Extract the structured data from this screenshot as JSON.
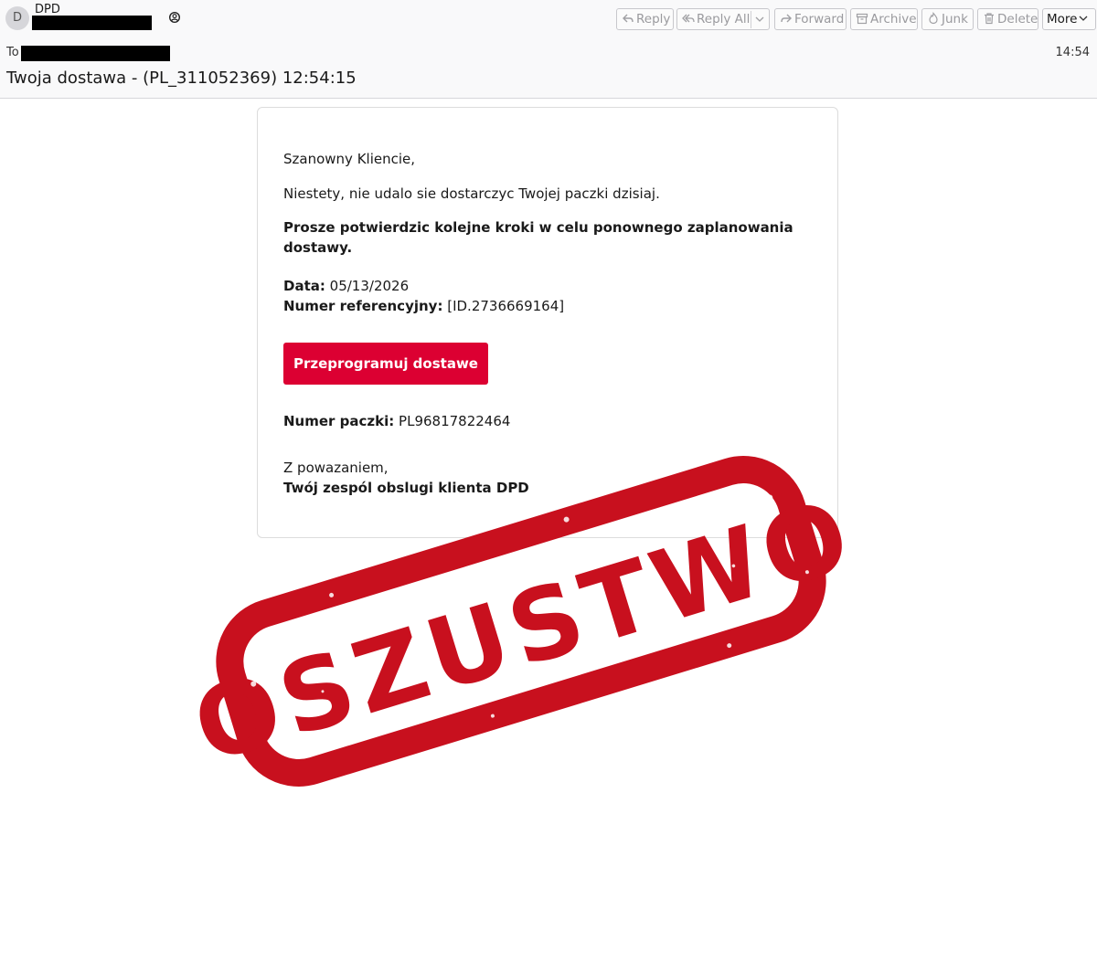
{
  "header": {
    "avatar_initial": "D",
    "from_name": "DPD",
    "to_label": "To",
    "time": "14:54",
    "subject": "Twoja dostawa - (PL_311052369) 12:54:15"
  },
  "toolbar": {
    "reply": "Reply",
    "reply_all": "Reply All",
    "forward": "Forward",
    "archive": "Archive",
    "junk": "Junk",
    "delete": "Delete",
    "more": "More"
  },
  "email": {
    "greeting": "Szanowny Kliencie,",
    "line1": "Niestety, nie udalo sie dostarczyc Twojej paczki dzisiaj.",
    "line2": "Prosze potwierdzic kolejne kroki w celu ponownego zaplanowania dostawy.",
    "date_label": "Data:",
    "date_value": "05/13/2026",
    "ref_label": "Numer referencyjny:",
    "ref_value": "[ID.2736669164]",
    "button_label": "Przeprogramuj dostawe",
    "parcel_label": "Numer paczki:",
    "parcel_value": "PL96817822464",
    "closing": "Z powazaniem,",
    "signature": "Twój zespól obslugi klienta DPD"
  },
  "stamp": {
    "text": "OSZUSTWO",
    "color": "#c8101e"
  },
  "colors": {
    "cta": "#dc0032",
    "header_bg": "#f9f9fa"
  }
}
